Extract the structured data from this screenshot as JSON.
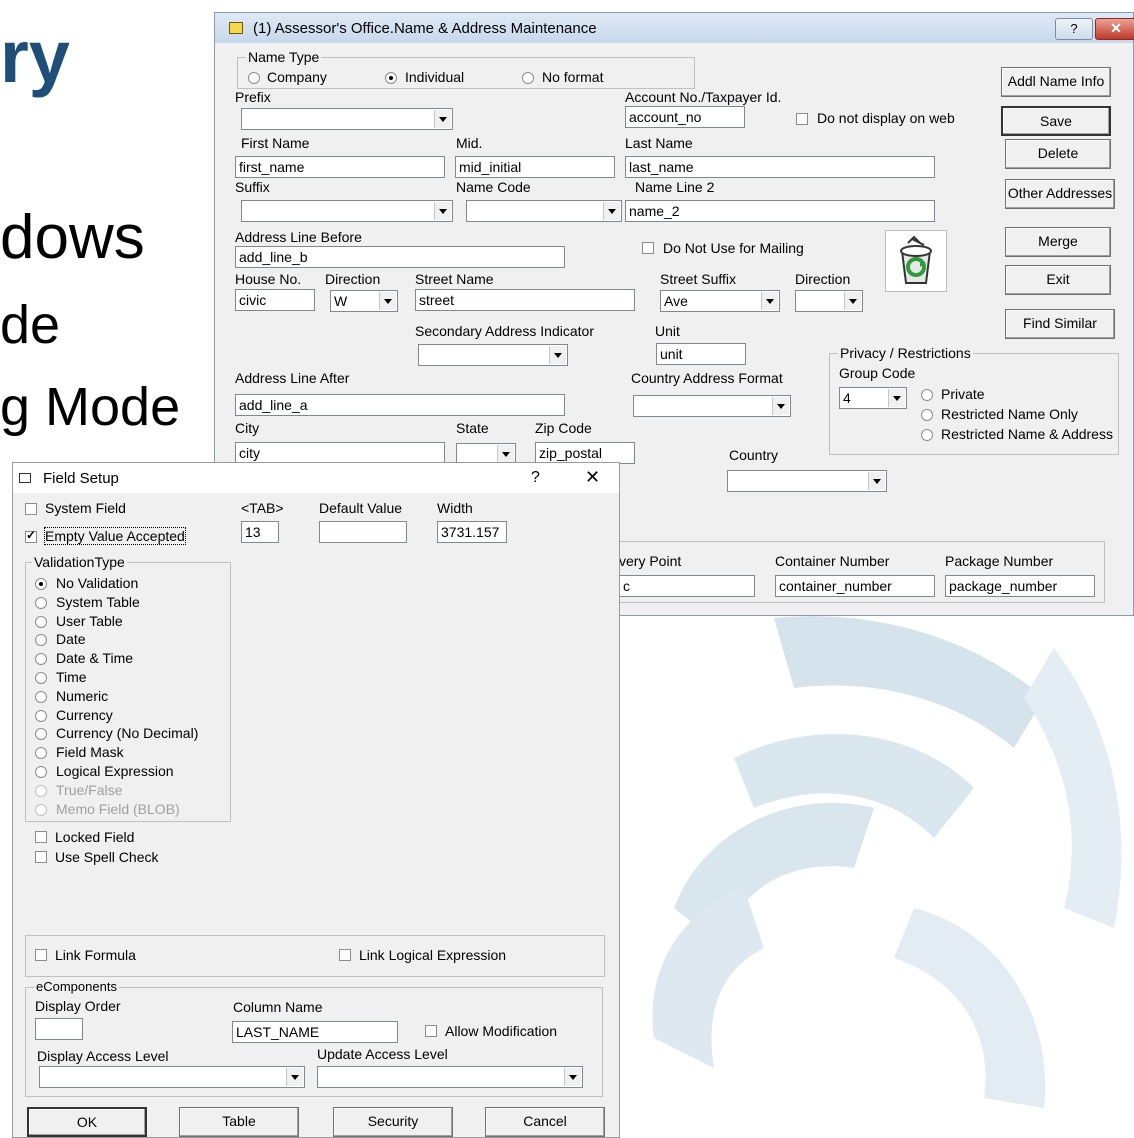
{
  "background": {
    "fragments": [
      "ry",
      "dows",
      "de",
      "g Mode"
    ],
    "accent_color": "#1f4e79",
    "swirl_color": "#c9dbe6"
  },
  "main_window": {
    "title": "(1) Assessor's Office.Name & Address Maintenance",
    "help_icon": "question-icon",
    "close_icon": "close-icon",
    "name_type": {
      "label": "Name Type",
      "options": [
        {
          "label": "Company",
          "selected": false
        },
        {
          "label": "Individual",
          "selected": true
        },
        {
          "label": "No format",
          "selected": false
        }
      ]
    },
    "labels": {
      "prefix": "Prefix",
      "account": "Account No./Taxpayer Id.",
      "do_not_display": "Do not display on web",
      "first_name": "First Name",
      "mid": "Mid.",
      "last_name": "Last Name",
      "suffix": "Suffix",
      "name_code": "Name Code",
      "name_line2": "Name Line 2",
      "address_before": "Address Line Before",
      "do_not_use_mailing": "Do Not Use for Mailing",
      "house_no": "House No.",
      "direction": "Direction",
      "street_name": "Street Name",
      "street_suffix": "Street Suffix",
      "direction2": "Direction",
      "secondary": "Secondary Address Indicator",
      "unit": "Unit",
      "address_after": "Address Line After",
      "country_format": "Country Address Format",
      "city": "City",
      "state": "State",
      "zip": "Zip Code",
      "country": "Country",
      "delivery_point": "very Point",
      "container_number": "Container Number",
      "package_number": "Package Number"
    },
    "values": {
      "account": "account_no",
      "first_name": "first_name",
      "mid": "mid_initial",
      "last_name": "last_name",
      "name_line2": "name_2",
      "address_before": "add_line_b",
      "house_no": "civic",
      "direction": "W",
      "street_name": "street",
      "street_suffix": "Ave",
      "unit": "unit",
      "address_after": "add_line_a",
      "city": "city",
      "zip": "zip_postal",
      "delivery_point": "c",
      "container_number": "container_number",
      "package_number": "package_number",
      "group_code": "4"
    },
    "privacy": {
      "label": "Privacy / Restrictions",
      "group_code_label": "Group Code",
      "options": [
        "Private",
        "Restricted Name Only",
        "Restricted Name & Address"
      ]
    },
    "buttons": {
      "addl_name": "Addl Name Info",
      "save": "Save",
      "delete": "Delete",
      "other_addresses": "Other Addresses",
      "merge": "Merge",
      "exit": "Exit",
      "find_similar": "Find Similar"
    },
    "recycle_icon": "recycle-bin-icon"
  },
  "field_setup": {
    "title": "Field Setup",
    "help": "?",
    "close": "✕",
    "system_field": {
      "label": "System Field",
      "checked": false
    },
    "empty_value": {
      "label": "Empty Value Accepted",
      "checked": true
    },
    "tab_label": "<TAB>",
    "tab_value": "13",
    "default_label": "Default Value",
    "default_value": "",
    "width_label": "Width",
    "width_value": "3731.157",
    "validation": {
      "label": "ValidationType",
      "options": [
        {
          "label": "No Validation",
          "selected": true,
          "disabled": false
        },
        {
          "label": "System Table",
          "selected": false,
          "disabled": false
        },
        {
          "label": "User Table",
          "selected": false,
          "disabled": false
        },
        {
          "label": "Date",
          "selected": false,
          "disabled": false
        },
        {
          "label": "Date & Time",
          "selected": false,
          "disabled": false
        },
        {
          "label": "Time",
          "selected": false,
          "disabled": false
        },
        {
          "label": "Numeric",
          "selected": false,
          "disabled": false
        },
        {
          "label": "Currency",
          "selected": false,
          "disabled": false
        },
        {
          "label": "Currency (No Decimal)",
          "selected": false,
          "disabled": false
        },
        {
          "label": "Field Mask",
          "selected": false,
          "disabled": false
        },
        {
          "label": "Logical Expression",
          "selected": false,
          "disabled": false
        },
        {
          "label": "True/False",
          "selected": false,
          "disabled": true
        },
        {
          "label": "Memo Field (BLOB)",
          "selected": false,
          "disabled": true
        }
      ]
    },
    "locked_field": "Locked Field",
    "spell_check": "Use Spell Check",
    "link_formula": "Link Formula",
    "link_logical": "Link Logical Expression",
    "ecomponents": {
      "label": "eComponents",
      "display_order": "Display Order",
      "column_name_label": "Column Name",
      "column_name_value": "LAST_NAME",
      "allow_modification": "Allow Modification",
      "display_access": "Display Access Level",
      "update_access": "Update Access Level"
    },
    "buttons": {
      "ok": "OK",
      "table": "Table",
      "security": "Security",
      "cancel": "Cancel"
    }
  }
}
